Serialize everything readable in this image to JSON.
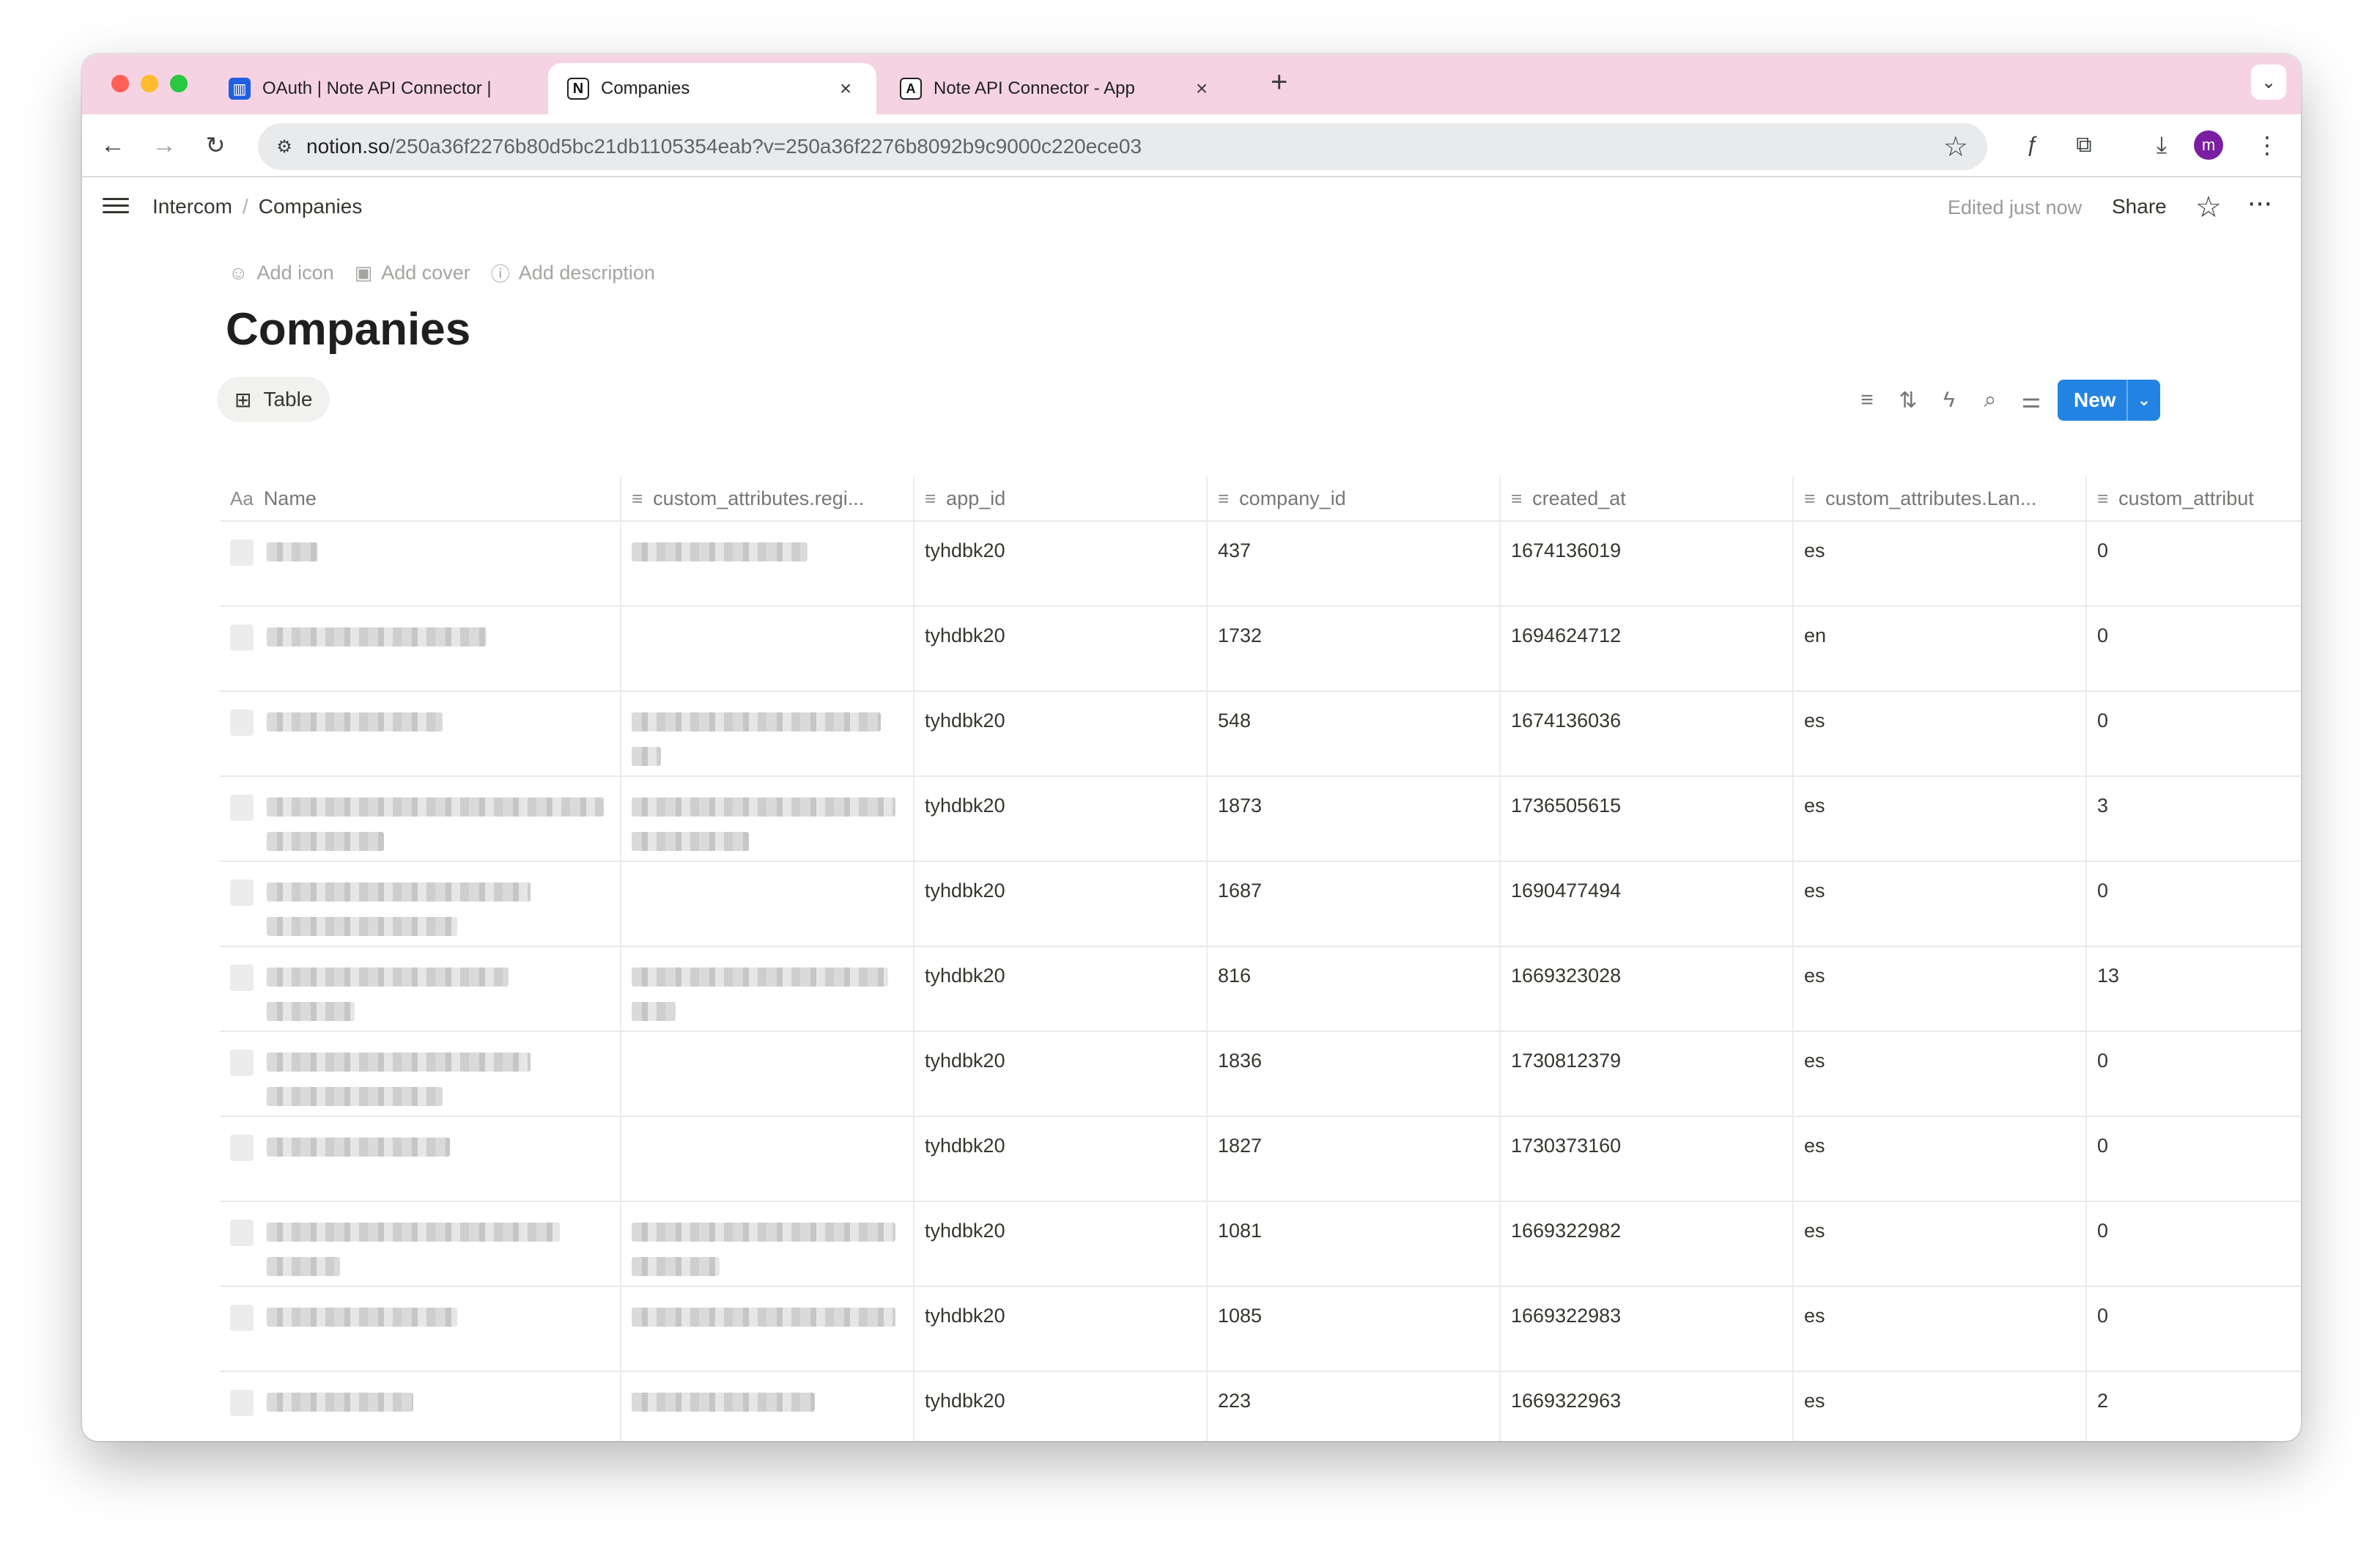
{
  "browser": {
    "tabs": [
      {
        "title": "OAuth | Note API Connector |",
        "icon": "intercom-icon",
        "active": false
      },
      {
        "title": "Companies",
        "icon": "notion-icon",
        "active": true
      },
      {
        "title": "Note API Connector - App",
        "icon": "app-icon",
        "active": false
      }
    ],
    "url_host": "notion.so",
    "url_path": "/250a36f2276b80d5bc21db1105354eab?v=250a36f2276b8092b9c9000c220ece03",
    "avatar_letter": "m"
  },
  "header": {
    "breadcrumb": [
      "Intercom",
      "Companies"
    ],
    "edited": "Edited just now",
    "share": "Share"
  },
  "page": {
    "actions": [
      "Add icon",
      "Add cover",
      "Add description"
    ],
    "title": "Companies",
    "view_tab": "Table",
    "new_button": "New"
  },
  "table": {
    "columns": [
      "Name",
      "custom_attributes.regi...",
      "app_id",
      "company_id",
      "created_at",
      "custom_attributes.Lan...",
      "custom_attribut"
    ],
    "rows": [
      {
        "app_id": "tyhdbk20",
        "company_id": "437",
        "created_at": "1674136019",
        "lang": "es",
        "last": "0"
      },
      {
        "app_id": "tyhdbk20",
        "company_id": "1732",
        "created_at": "1694624712",
        "lang": "en",
        "last": "0"
      },
      {
        "app_id": "tyhdbk20",
        "company_id": "548",
        "created_at": "1674136036",
        "lang": "es",
        "last": "0"
      },
      {
        "app_id": "tyhdbk20",
        "company_id": "1873",
        "created_at": "1736505615",
        "lang": "es",
        "last": "3"
      },
      {
        "app_id": "tyhdbk20",
        "company_id": "1687",
        "created_at": "1690477494",
        "lang": "es",
        "last": "0"
      },
      {
        "app_id": "tyhdbk20",
        "company_id": "816",
        "created_at": "1669323028",
        "lang": "es",
        "last": "13"
      },
      {
        "app_id": "tyhdbk20",
        "company_id": "1836",
        "created_at": "1730812379",
        "lang": "es",
        "last": "0"
      },
      {
        "app_id": "tyhdbk20",
        "company_id": "1827",
        "created_at": "1730373160",
        "lang": "es",
        "last": "0"
      },
      {
        "app_id": "tyhdbk20",
        "company_id": "1081",
        "created_at": "1669322982",
        "lang": "es",
        "last": "0"
      },
      {
        "app_id": "tyhdbk20",
        "company_id": "1085",
        "created_at": "1669322983",
        "lang": "es",
        "last": "0"
      },
      {
        "app_id": "tyhdbk20",
        "company_id": "223",
        "created_at": "1669322963",
        "lang": "es",
        "last": "2"
      }
    ]
  },
  "colors": {
    "tabstrip": "#f6d3e3",
    "accent": "#2383e2",
    "avatar": "#7b1fa2"
  }
}
